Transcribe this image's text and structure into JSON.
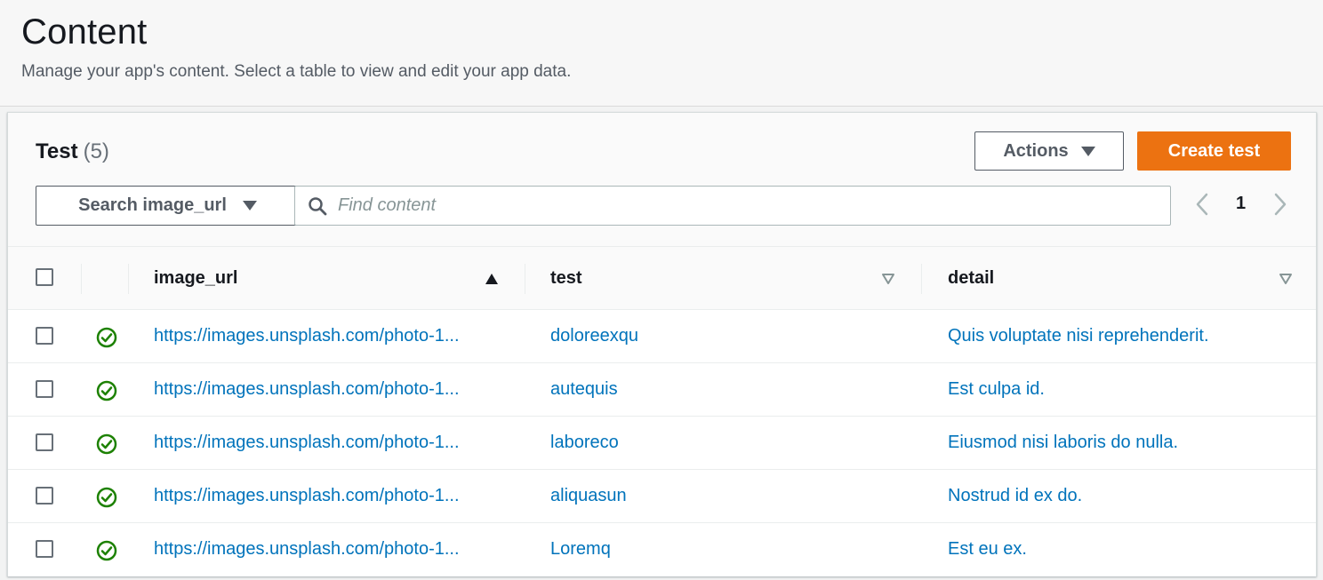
{
  "page": {
    "title": "Content",
    "description": "Manage your app's content. Select a table to view and edit your app data."
  },
  "panel": {
    "title": "Test",
    "count": "(5)",
    "actions_label": "Actions",
    "create_label": "Create test"
  },
  "search": {
    "field_select_label": "Search image_url",
    "placeholder": "Find content",
    "value": ""
  },
  "pagination": {
    "current_page": "1"
  },
  "table": {
    "columns": [
      {
        "label": "image_url",
        "sort": "ascending"
      },
      {
        "label": "test",
        "sort": "none"
      },
      {
        "label": "detail",
        "sort": "none"
      }
    ],
    "rows": [
      {
        "status": "check-circle-icon",
        "image_url": "https://images.unsplash.com/photo-1...",
        "test": "doloreexqu",
        "detail": "Quis voluptate nisi reprehenderit."
      },
      {
        "status": "check-circle-icon",
        "image_url": "https://images.unsplash.com/photo-1...",
        "test": "autequis",
        "detail": "Est culpa id."
      },
      {
        "status": "check-circle-icon",
        "image_url": "https://images.unsplash.com/photo-1...",
        "test": "laboreco",
        "detail": "Eiusmod nisi laboris do nulla."
      },
      {
        "status": "check-circle-icon",
        "image_url": "https://images.unsplash.com/photo-1...",
        "test": "aliquasun",
        "detail": "Nostrud id ex do."
      },
      {
        "status": "check-circle-icon",
        "image_url": "https://images.unsplash.com/photo-1...",
        "test": "Loremq",
        "detail": "Est eu ex."
      }
    ]
  },
  "colors": {
    "accent": "#ec7211",
    "link": "#0073bb",
    "success": "#1d8102"
  }
}
